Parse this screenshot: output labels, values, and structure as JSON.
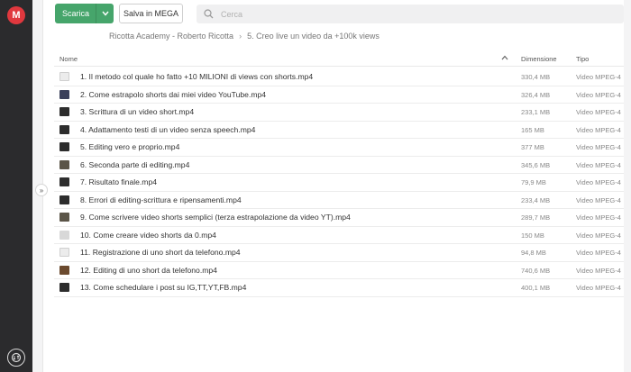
{
  "app": {
    "logo_letter": "M",
    "accent_color": "#e0383e"
  },
  "toolbar": {
    "download_label": "Scarica",
    "save_label": "Salva in MEGA",
    "download_color": "#46a56b"
  },
  "search": {
    "placeholder": "Cerca"
  },
  "breadcrumb": {
    "items": [
      "Ricotta Academy - Roberto Ricotta",
      "5. Creo live un video da +100k views"
    ],
    "separator": "›"
  },
  "table": {
    "columns": {
      "name": "Nome",
      "size": "Dimensione",
      "type": "Tipo"
    },
    "sort": "ascending",
    "rows": [
      {
        "name": "1. Il metodo col quale ho fatto +10 MILIONI di views con shorts.mp4",
        "size": "330,4 MB",
        "type": "Video MPEG-4",
        "thumb": "t-white"
      },
      {
        "name": "2. Come estrapolo shorts dai miei video YouTube.mp4",
        "size": "326,4 MB",
        "type": "Video MPEG-4",
        "thumb": "t-blue"
      },
      {
        "name": "3. Scrittura di un video short.mp4",
        "size": "233,1 MB",
        "type": "Video MPEG-4",
        "thumb": "t-dark"
      },
      {
        "name": "4. Adattamento testi di un video senza speech.mp4",
        "size": "165 MB",
        "type": "Video MPEG-4",
        "thumb": "t-dark"
      },
      {
        "name": "5. Editing vero e proprio.mp4",
        "size": "377 MB",
        "type": "Video MPEG-4",
        "thumb": "t-dark"
      },
      {
        "name": "6. Seconda parte di editing.mp4",
        "size": "345,6 MB",
        "type": "Video MPEG-4",
        "thumb": "t-mid"
      },
      {
        "name": "7. Risultato finale.mp4",
        "size": "79,9 MB",
        "type": "Video MPEG-4",
        "thumb": "t-dark"
      },
      {
        "name": "8. Errori di editing-scrittura e ripensamenti.mp4",
        "size": "233,4 MB",
        "type": "Video MPEG-4",
        "thumb": "t-dark"
      },
      {
        "name": "9. Come scrivere video shorts semplici (terza estrapolazione da video YT).mp4",
        "size": "289,7 MB",
        "type": "Video MPEG-4",
        "thumb": "t-mid"
      },
      {
        "name": "10. Come creare video shorts da 0.mp4",
        "size": "150 MB",
        "type": "Video MPEG-4",
        "thumb": "t-light"
      },
      {
        "name": "11. Registrazione di uno short da telefono.mp4",
        "size": "94,8 MB",
        "type": "Video MPEG-4",
        "thumb": "t-white"
      },
      {
        "name": "12. Editing di uno short da telefono.mp4",
        "size": "740,6 MB",
        "type": "Video MPEG-4",
        "thumb": "t-brown"
      },
      {
        "name": "13. Come schedulare i post su IG,TT,YT,FB.mp4",
        "size": "400,1 MB",
        "type": "Video MPEG-4",
        "thumb": "t-dark"
      }
    ]
  },
  "icons": {
    "search": "search-icon",
    "caret": "chevron-down-icon",
    "panel_toggle": "double-chevron-right-icon",
    "bottom": "transfer-manager-icon"
  }
}
